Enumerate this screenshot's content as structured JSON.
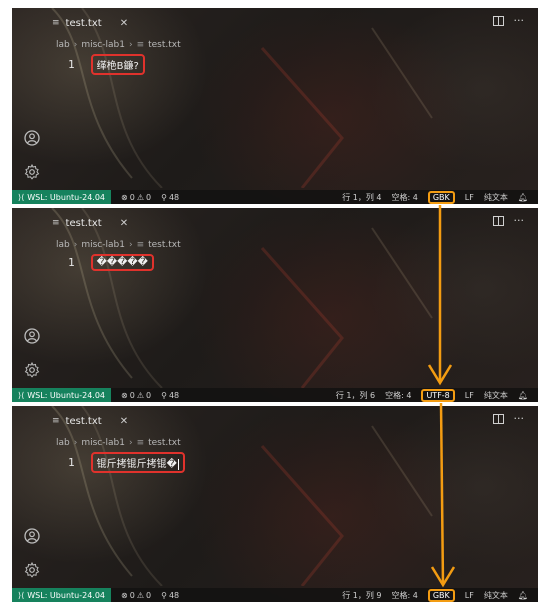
{
  "panels": [
    {
      "tab": {
        "filename": "test.txt"
      },
      "breadcrumb": {
        "root": "lab",
        "folder": "misc-lab1",
        "file": "test.txt"
      },
      "editor": {
        "line_number": "1",
        "content": "缂栬В鐮?"
      },
      "status": {
        "remote": "WSL: Ubuntu-24.04",
        "errors": "0",
        "warnings": "0",
        "ports": "48",
        "cursor_pos": "行 1，列 4",
        "spaces": "空格: 4",
        "encoding": "GBK",
        "eol": "LF",
        "language": "纯文本"
      }
    },
    {
      "tab": {
        "filename": "test.txt"
      },
      "breadcrumb": {
        "root": "lab",
        "folder": "misc-lab1",
        "file": "test.txt"
      },
      "editor": {
        "line_number": "1",
        "content": "�����"
      },
      "status": {
        "remote": "WSL: Ubuntu-24.04",
        "errors": "0",
        "warnings": "0",
        "ports": "48",
        "cursor_pos": "行 1，列 6",
        "spaces": "空格: 4",
        "encoding": "UTF-8",
        "eol": "LF",
        "language": "纯文本"
      }
    },
    {
      "tab": {
        "filename": "test.txt"
      },
      "breadcrumb": {
        "root": "lab",
        "folder": "misc-lab1",
        "file": "test.txt"
      },
      "editor": {
        "line_number": "1",
        "content": "锟斤拷锟斤拷锟�"
      },
      "status": {
        "remote": "WSL: Ubuntu-24.04",
        "errors": "0",
        "warnings": "0",
        "ports": "48",
        "cursor_pos": "行 1，列 9",
        "spaces": "空格: 4",
        "encoding": "GBK",
        "eol": "LF",
        "language": "纯文本"
      }
    }
  ],
  "colors": {
    "highlight_red": "#e0322c",
    "arrow_orange": "#f39c12",
    "remote_green": "#16825d"
  },
  "icons": [
    "file-icon",
    "close-icon",
    "split-editor-icon",
    "more-icon",
    "account-icon",
    "gear-icon",
    "remote-icon",
    "error-icon",
    "warning-icon",
    "ports-icon",
    "bell-icon"
  ]
}
